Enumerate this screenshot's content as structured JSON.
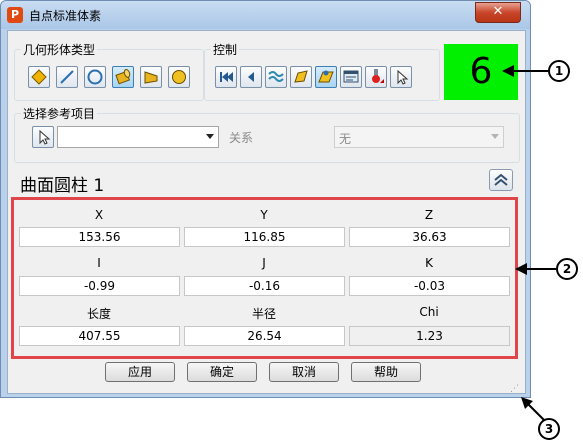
{
  "window": {
    "app_icon": "P",
    "title": "自点标准体素",
    "close_glyph": "✕"
  },
  "geometry_group": {
    "label": "几何形体类型",
    "buttons": [
      "plane-icon",
      "line-icon",
      "circle-icon",
      "cylinder-icon",
      "cone-icon",
      "sphere-icon"
    ],
    "selected": "cylinder-icon"
  },
  "control_group": {
    "label": "控制",
    "buttons": [
      "first-icon",
      "previous-icon",
      "wave-icon",
      "surface-icon",
      "point-icon",
      "screen-icon",
      "probe-icon",
      "cursor-icon"
    ]
  },
  "counter": {
    "value": "6",
    "background": "#00f000"
  },
  "reference": {
    "label": "选择参考项目",
    "select_value": "",
    "relation_label": "关系",
    "relation_value": "无"
  },
  "section": {
    "title": "曲面圆柱 1"
  },
  "fields": {
    "row1": [
      {
        "label": "X",
        "value": "153.56"
      },
      {
        "label": "Y",
        "value": "116.85"
      },
      {
        "label": "Z",
        "value": "36.63"
      }
    ],
    "row2": [
      {
        "label": "I",
        "value": "-0.99"
      },
      {
        "label": "J",
        "value": "-0.16"
      },
      {
        "label": "K",
        "value": "-0.03"
      }
    ],
    "row3": [
      {
        "label": "长度",
        "value": "407.55"
      },
      {
        "label": "半径",
        "value": "26.54"
      },
      {
        "label": "Chi",
        "value": "1.23"
      }
    ]
  },
  "buttons": {
    "apply": "应用",
    "ok": "确定",
    "cancel": "取消",
    "help": "帮助"
  },
  "callouts": [
    "1",
    "2",
    "3"
  ],
  "colors": {
    "highlight_frame": "#e0454a",
    "counter_bg": "#00f000"
  }
}
